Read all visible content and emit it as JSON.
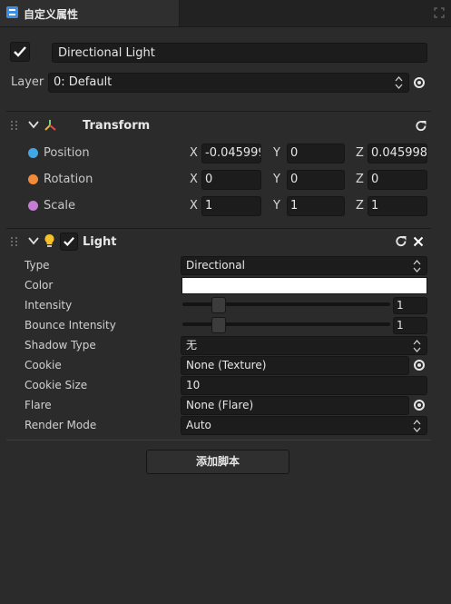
{
  "tab": {
    "title": "自定义属性"
  },
  "object": {
    "name": "Directional Light",
    "layer_label": "Layer",
    "layer_value": "0: Default"
  },
  "transform": {
    "title": "Transform",
    "rows": [
      {
        "label": "Position",
        "color": "#3fa7e6",
        "x": "-0.045999",
        "y": "0",
        "z": "0.0459985"
      },
      {
        "label": "Rotation",
        "color": "#f08b3a",
        "x": "0",
        "y": "0",
        "z": "0"
      },
      {
        "label": "Scale",
        "color": "#c77ad6",
        "x": "1",
        "y": "1",
        "z": "1"
      }
    ],
    "axes": {
      "x": "X",
      "y": "Y",
      "z": "Z"
    }
  },
  "light": {
    "title": "Light",
    "type_label": "Type",
    "type_value": "Directional",
    "color_label": "Color",
    "color_value": "#ffffff",
    "intensity_label": "Intensity",
    "intensity_value": "1",
    "intensity_level": 0.15,
    "bounce_label": "Bounce Intensity",
    "bounce_value": "1",
    "bounce_level": 0.15,
    "shadow_label": "Shadow Type",
    "shadow_value": "无",
    "cookie_label": "Cookie",
    "cookie_value": "None (Texture)",
    "cookie_size_label": "Cookie Size",
    "cookie_size_value": "10",
    "flare_label": "Flare",
    "flare_value": "None (Flare)",
    "render_mode_label": "Render Mode",
    "render_mode_value": "Auto"
  },
  "add_script_label": "添加脚本"
}
